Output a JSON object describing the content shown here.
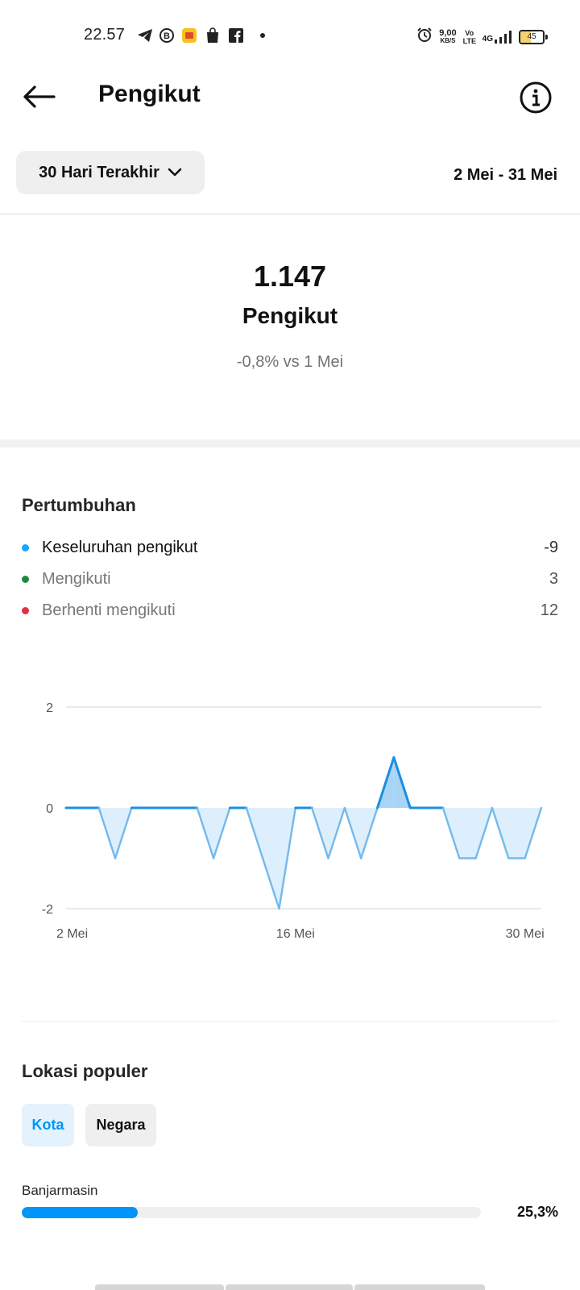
{
  "status_bar": {
    "time": "22.57",
    "speed_value": "9,00",
    "speed_unit": "KB/S",
    "volte": "Vo LTE",
    "network": "4G",
    "battery": "45",
    "battery_level": 0.45
  },
  "header": {
    "title": "Pengikut"
  },
  "range": {
    "label": "30 Hari Terakhir",
    "dates": "2 Mei - 31 Mei"
  },
  "summary": {
    "total": "1.147",
    "label": "Pengikut",
    "change": "-0,8% vs 1 Mei"
  },
  "growth": {
    "title": "Pertumbuhan",
    "legend": [
      {
        "label": "Keseluruhan pengikut",
        "value": "-9",
        "color": "#1aa3ff"
      },
      {
        "label": "Mengikuti",
        "value": "3",
        "color": "#1f8a3a"
      },
      {
        "label": "Berhenti mengikuti",
        "value": "12",
        "color": "#e0313d"
      }
    ]
  },
  "chart_data": {
    "type": "area",
    "title": "",
    "xlabel": "",
    "ylabel": "",
    "x_tick_labels": [
      "2 Mei",
      "16 Mei",
      "30 Mei"
    ],
    "y_ticks": [
      2,
      0,
      -2
    ],
    "ylim": [
      -2,
      2
    ],
    "grid": true,
    "series": [
      {
        "color": "#1a8fe0",
        "x": [
          "2 Mei",
          "3 Mei",
          "4 Mei",
          "5 Mei",
          "6 Mei",
          "7 Mei",
          "8 Mei",
          "9 Mei",
          "10 Mei",
          "11 Mei",
          "12 Mei",
          "13 Mei",
          "14 Mei",
          "15 Mei",
          "16 Mei",
          "17 Mei",
          "18 Mei",
          "19 Mei",
          "20 Mei",
          "21 Mei",
          "22 Mei",
          "23 Mei",
          "24 Mei",
          "25 Mei",
          "26 Mei",
          "27 Mei",
          "28 Mei",
          "29 Mei",
          "30 Mei",
          "31 Mei"
        ],
        "values": [
          0,
          0,
          0,
          -1,
          0,
          0,
          0,
          0,
          0,
          -1,
          0,
          0,
          -1,
          -2,
          0,
          0,
          -1,
          0,
          -1,
          0,
          1,
          0,
          0,
          0,
          -1,
          -1,
          0,
          -1,
          -1,
          0
        ]
      }
    ]
  },
  "locations": {
    "title": "Lokasi populer",
    "tabs": [
      "Kota",
      "Negara"
    ],
    "items": [
      {
        "name": "Banjarmasin",
        "percent": "25,3%",
        "fraction": 0.253
      }
    ]
  }
}
